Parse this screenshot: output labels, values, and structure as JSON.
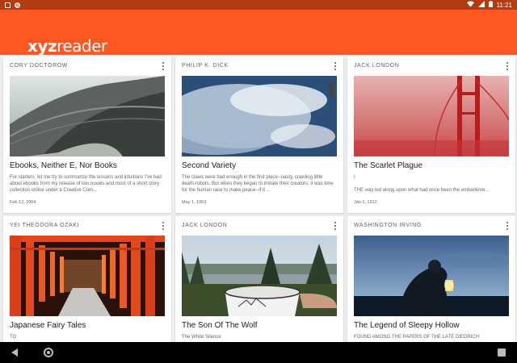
{
  "status_bar": {
    "time": "11:21"
  },
  "app": {
    "logo_bold": "xyz",
    "logo_regular": "reader",
    "accent": "#ff5722",
    "status_color": "#b23c12"
  },
  "cards": [
    {
      "author": "Cory Doctorow",
      "title": "Ebooks, Neither E, Nor Books",
      "excerpt": "For starters, let me try to summarize the lessons and intuitions I've had about ebooks from my release of two novels and most of a short story collection online under a Creative Com...",
      "date": "Feb 12, 2004",
      "image": "architecture-roof"
    },
    {
      "author": "Philip K. Dick",
      "title": "Second Variety",
      "excerpt": "The claws were bad enough in the first place--nasty, crawling little death-robots. But when they began to imitate their creators, it was time for the human race to make peace--if it ...",
      "date": "May 1, 1953",
      "image": "earth-clouds"
    },
    {
      "author": "Jack London",
      "title": "The Scarlet Plague",
      "excerpt": "I\n\nTHE way led along upon what had once been the embankme...",
      "date": "Jan 1, 1912",
      "image": "red-bridge-fog"
    },
    {
      "author": "Yei Theodora Ozaki",
      "title": "Japanese Fairy Tales",
      "excerpt": "TO",
      "date": "",
      "image": "torii-gates"
    },
    {
      "author": "Jack London",
      "title": "The Son Of The Wolf",
      "excerpt": "The White Silence",
      "date": "",
      "image": "camping-mug"
    },
    {
      "author": "Washington Irving",
      "title": "The Legend of Sleepy Hollow",
      "excerpt": "FOUND AMONG THE PAPERS OF THE LATE DIEDRICH",
      "date": "",
      "image": "lantern-night"
    }
  ]
}
